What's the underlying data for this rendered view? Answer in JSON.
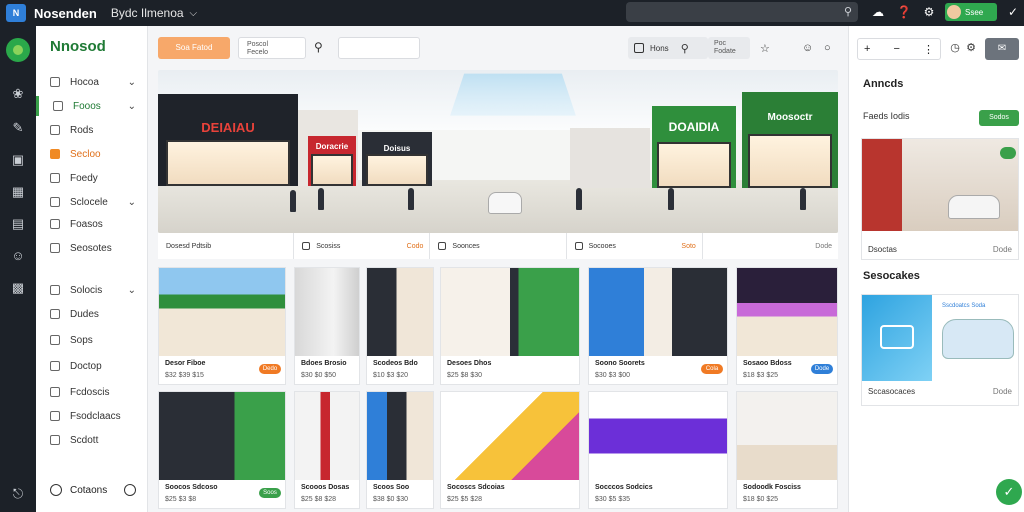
{
  "topbar": {
    "logo": "N",
    "title": "Nosenden",
    "subtitle": "Bydc Ilmenoa",
    "user_name": "Ssee"
  },
  "sidebar": {
    "brand": "Nnosod",
    "items": [
      {
        "label": "Hocoa",
        "chevron": true
      },
      {
        "label": "Fooos",
        "chevron": true
      },
      {
        "label": "Rods",
        "chevron": false
      },
      {
        "label": "Secloo",
        "chevron": false
      },
      {
        "label": "Foedy",
        "chevron": false
      },
      {
        "label": "Sclocele",
        "chevron": true
      },
      {
        "label": "Foasos",
        "chevron": false
      },
      {
        "label": "Seosotes",
        "chevron": false
      },
      {
        "label": "Solocis",
        "chevron": true
      },
      {
        "label": "Dudes",
        "chevron": false
      },
      {
        "label": "Sops",
        "chevron": false
      },
      {
        "label": "Doctop",
        "chevron": false
      },
      {
        "label": "Fcdoscis",
        "chevron": false
      },
      {
        "label": "Fsodclaacs",
        "chevron": false
      },
      {
        "label": "Scdott",
        "chevron": false
      }
    ],
    "footer_label": "Cotaons"
  },
  "toolbar": {
    "primary_button": "Soa Fatod",
    "field1_line1": "Poscol",
    "field1_line2": "Fecelo",
    "right_label": "Hons",
    "field2_line1": "Poc",
    "field2_line2": "Fodate"
  },
  "hero": {
    "sign_left": "DEIAIAU",
    "sign_mid1": "Doracrie",
    "sign_mid2": "Doisus",
    "sign_right1": "DOAIDIA",
    "sign_right2": "Moosoctr",
    "strip": [
      {
        "label": "Dosesd Pdtsib",
        "end": ""
      },
      {
        "label": "Scosiss",
        "end": "Codo"
      },
      {
        "label": "Soonces",
        "end": ""
      },
      {
        "label": "Socooes",
        "end": "Soto"
      },
      {
        "label": "",
        "end": "Dode"
      }
    ]
  },
  "products_row1": [
    {
      "title": "Desor Fiboe",
      "price": "$32 $39 $15",
      "badge": "Dedo",
      "badge_color": "#f07a24"
    },
    {
      "title": "Bdoes Brosio",
      "price": "$30 $0 $50",
      "badge": "",
      "badge_color": ""
    },
    {
      "title": "Scodeos Bdo",
      "price": "$10 $3 $20",
      "badge": "",
      "badge_color": ""
    },
    {
      "title": "Desoes Dhos",
      "price": "$25 $8 $30",
      "badge": "",
      "badge_color": ""
    },
    {
      "title": "Soono Soorets",
      "price": "$30 $3 $00",
      "badge": "Cola",
      "badge_color": "#f07a24"
    },
    {
      "title": "Sosaoo Bdoss",
      "price": "$18 $3 $25",
      "badge": "Dode",
      "badge_color": "#2f7fd8"
    }
  ],
  "products_row2": [
    {
      "title": "Soocos Sdcoso",
      "price": "$25 $3 $8",
      "badge": "Soos",
      "badge_color": "#3aa04a"
    },
    {
      "title": "Scooos Dosas",
      "price": "$25 $8 $28",
      "badge": "",
      "badge_color": ""
    },
    {
      "title": "Scoos Soo",
      "price": "$38 $0 $30",
      "badge": "",
      "badge_color": ""
    },
    {
      "title": "Socoscs Sdcoias",
      "price": "$25 $5 $28",
      "badge": "",
      "badge_color": ""
    },
    {
      "title": "Socccos Sodcics",
      "price": "$30 $5 $35",
      "badge": "",
      "badge_color": ""
    },
    {
      "title": "Sodoodk Fosciss",
      "price": "$18 $0 $25",
      "badge": "",
      "badge_color": ""
    }
  ],
  "right_panel": {
    "heading1": "Anncds",
    "row_label": "Faeds Iodis",
    "green_button": "Sodos",
    "card1_caption": "Dsoctas",
    "card1_end": "Dode",
    "heading2": "Sesocakes",
    "card2_tag": "Sscdoatcs Soda",
    "card2_caption": "Sccasocaces",
    "card2_end": "Dode"
  },
  "colors": {
    "accent_green": "#3aa04a",
    "accent_orange": "#f08a24",
    "dark_chrome": "#1c2128"
  },
  "icons": [
    "search-icon",
    "cloud-icon",
    "help-icon",
    "settings-icon",
    "home-icon",
    "plus-icon",
    "info-icon",
    "chat-icon"
  ]
}
